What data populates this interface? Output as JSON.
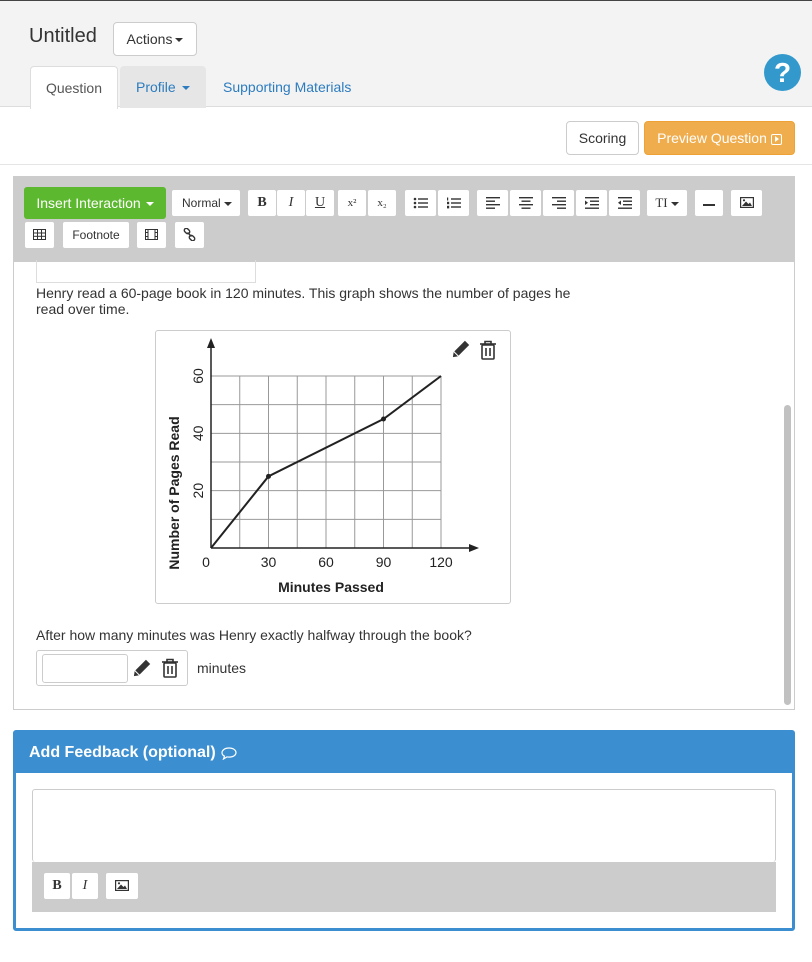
{
  "header": {
    "title": "Untitled",
    "actions_label": "Actions"
  },
  "tabs": [
    {
      "label": "Question",
      "active": true
    },
    {
      "label": "Profile"
    },
    {
      "label": "Supporting Materials"
    }
  ],
  "help_icon": "question-circle",
  "buttons": {
    "scoring": "Scoring",
    "preview": "Preview Question"
  },
  "toolbar": {
    "insert_interaction": "Insert Interaction",
    "format_select": "Normal",
    "bold": "B",
    "italic": "I",
    "underline": "U",
    "superscript": "x²",
    "subscript": "x₂",
    "text_style": "TI",
    "footnote": "Footnote"
  },
  "content": {
    "prompt": "Henry read a 60-page book in 120 minutes. This graph shows the number of pages he read over time.",
    "question": "After how many minutes was Henry exactly halfway through the book?",
    "answer_value": "",
    "answer_unit": "minutes"
  },
  "chart_data": {
    "type": "line",
    "xlabel": "Minutes Passed",
    "ylabel": "Number of Pages Read",
    "x": [
      0,
      30,
      90,
      120
    ],
    "y": [
      0,
      25,
      45,
      60
    ],
    "xticks": [
      "0",
      "30",
      "60",
      "90",
      "120"
    ],
    "yticks": [
      "20",
      "40",
      "60"
    ],
    "xlim": [
      0,
      120
    ],
    "ylim": [
      0,
      60
    ],
    "grid": true
  },
  "feedback": {
    "title": "Add Feedback (optional)",
    "bold": "B",
    "italic": "I"
  },
  "colors": {
    "insert": "#5cb82e",
    "preview": "#f0ad4e",
    "feedback": "#3b8fd0",
    "link": "#2c7cbf",
    "help": "#3399cc"
  }
}
